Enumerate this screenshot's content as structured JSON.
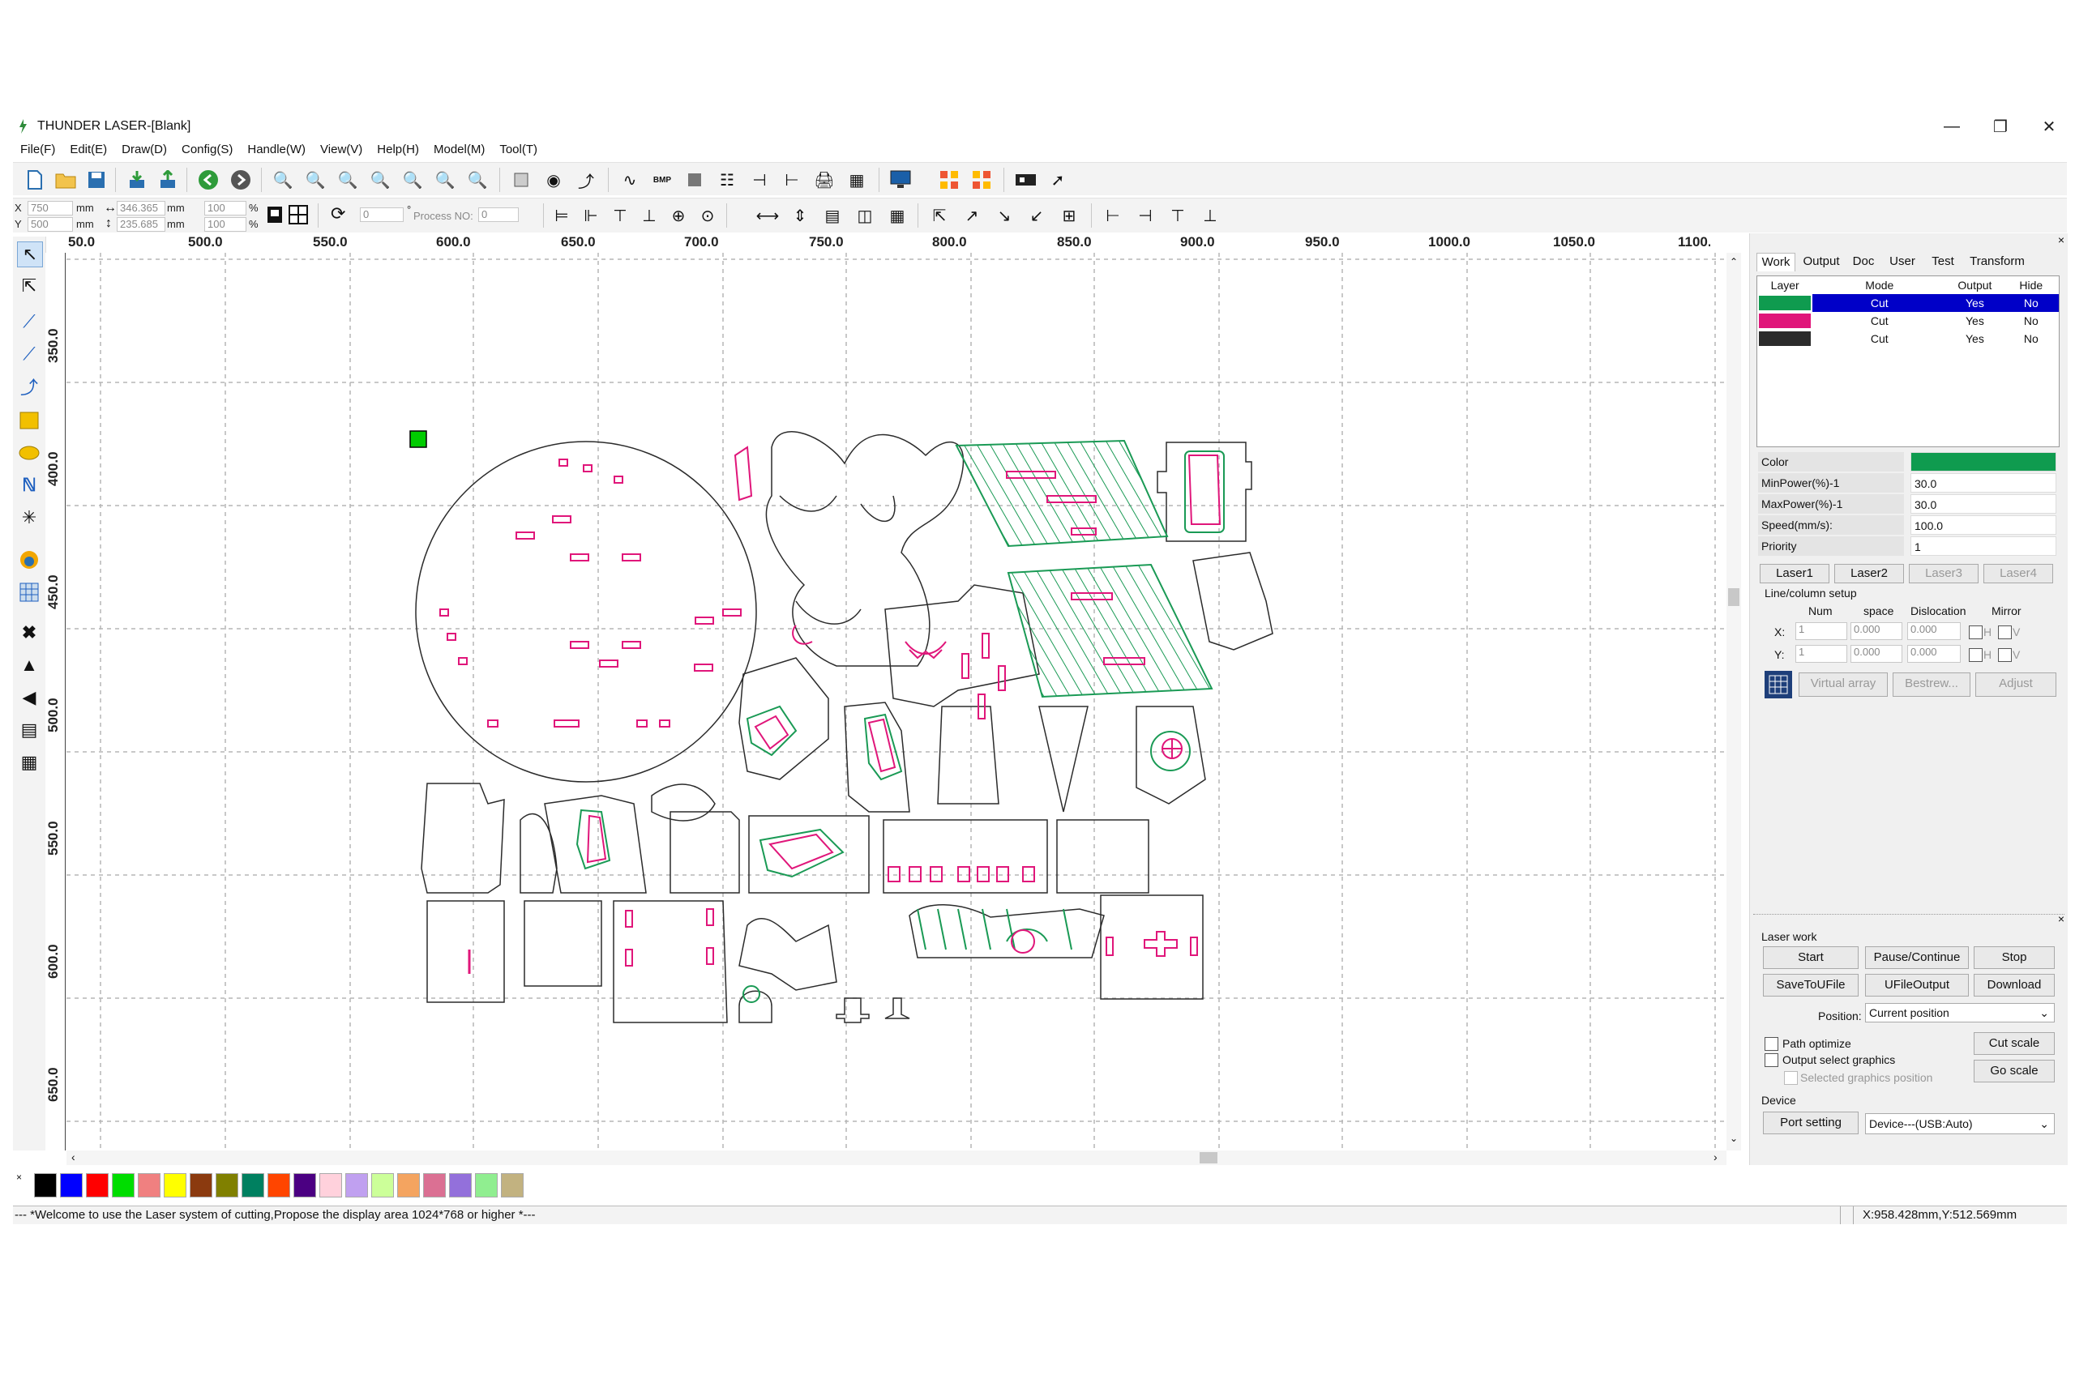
{
  "window": {
    "title": "THUNDER LASER-[Blank]",
    "minimize_icon": "minimize-icon",
    "restore_icon": "restore-icon",
    "close_icon": "close-icon"
  },
  "menu": [
    "File(F)",
    "Edit(E)",
    "Draw(D)",
    "Config(S)",
    "Handle(W)",
    "View(V)",
    "Help(H)",
    "Model(M)",
    "Tool(T)"
  ],
  "toolbar2": {
    "x_label": "X",
    "y_label": "Y",
    "x_value": "750",
    "y_value": "500",
    "mm": "mm",
    "width_value": "346.365",
    "height_value": "235.685",
    "scale_x": "100",
    "scale_y": "100",
    "percent": "%",
    "rotate_value": "0",
    "degree": "°",
    "process_no_label": "Process NO:",
    "process_no_value": "0"
  },
  "ruler": {
    "h_labels": [
      "50.0",
      "500.0",
      "550.0",
      "600.0",
      "650.0",
      "700.0",
      "750.0",
      "800.0",
      "850.0",
      "900.0",
      "950.0",
      "1000.0",
      "1050.0",
      "1100.0"
    ],
    "v_labels": [
      "350.0",
      "400.0",
      "450.0",
      "500.0",
      "550.0",
      "600.0",
      "650.0"
    ]
  },
  "right_panel": {
    "tabs": [
      "Work",
      "Output",
      "Doc",
      "User",
      "Test",
      "Transform"
    ],
    "layer_headers": [
      "Layer",
      "Mode",
      "Output",
      "Hide"
    ],
    "layers": [
      {
        "color": "#0f9b4f",
        "mode": "Cut",
        "output": "Yes",
        "hide": "No",
        "selected": true
      },
      {
        "color": "#e0167a",
        "mode": "Cut",
        "output": "Yes",
        "hide": "No",
        "selected": false
      },
      {
        "color": "#2b2b2b",
        "mode": "Cut",
        "output": "Yes",
        "hide": "No",
        "selected": false
      }
    ],
    "props": [
      {
        "name": "Color",
        "value": ""
      },
      {
        "name": "MinPower(%)-1",
        "value": "30.0"
      },
      {
        "name": "MaxPower(%)-1",
        "value": "30.0"
      },
      {
        "name": "Speed(mm/s):",
        "value": "100.0"
      },
      {
        "name": "Priority",
        "value": "1"
      }
    ],
    "prop_color": "#0f9b4f",
    "laser_tabs": [
      "Laser1",
      "Laser2",
      "Laser3",
      "Laser4"
    ],
    "line_column_setup": "Line/column setup",
    "array_headers": [
      "Num",
      "space",
      "Dislocation",
      "Mirror"
    ],
    "x_row": {
      "label": "X:",
      "num": "1",
      "space": "0.000",
      "dislocation": "0.000",
      "h": "H",
      "v": "V"
    },
    "y_row": {
      "label": "Y:",
      "num": "1",
      "space": "0.000",
      "dislocation": "0.000",
      "h": "H",
      "v": "V"
    },
    "array_buttons": [
      "Virtual array",
      "Bestrew...",
      "Adjust"
    ],
    "laser_work": "Laser work",
    "work_buttons_row1": [
      "Start",
      "Pause/Continue",
      "Stop"
    ],
    "work_buttons_row2": [
      "SaveToUFile",
      "UFileOutput",
      "Download"
    ],
    "position_label": "Position:",
    "position_value": "Current position",
    "path_optimize": "Path optimize",
    "output_select_graphics": "Output select graphics",
    "selected_graphics_position": "Selected graphics position",
    "cut_scale": "Cut scale",
    "go_scale": "Go scale",
    "device_label": "Device",
    "port_setting": "Port setting",
    "device_value": "Device---(USB:Auto)"
  },
  "palette": [
    "#000000",
    "#0000ff",
    "#ff0000",
    "#00dd00",
    "#f08080",
    "#ffff00",
    "#8b3a0f",
    "#808000",
    "#008060",
    "#ff4500",
    "#4b0082",
    "#ffd1dc",
    "#c0a0f0",
    "#ccff99",
    "#f4a460",
    "#db7093",
    "#9370db",
    "#90ee90",
    "#c2b280"
  ],
  "status": {
    "message": "--- *Welcome to use the Laser system of cutting,Propose the display area 1024*768 or higher *---",
    "coords": "X:958.428mm,Y:512.569mm"
  }
}
